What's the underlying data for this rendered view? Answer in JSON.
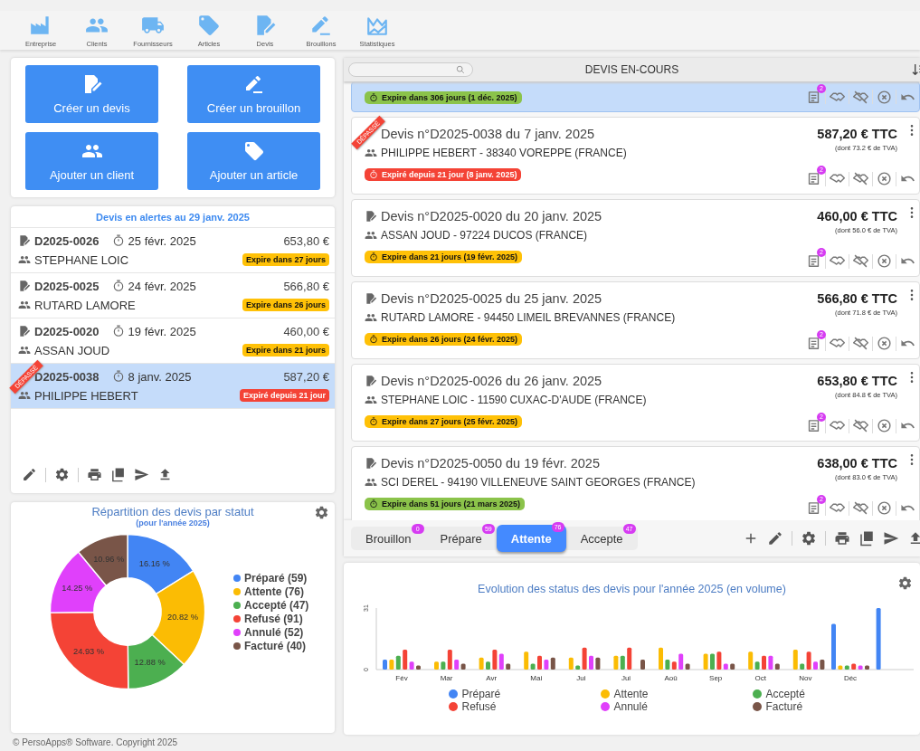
{
  "nav": [
    {
      "label": "Entreprise"
    },
    {
      "label": "Clients"
    },
    {
      "label": "Fournisseurs"
    },
    {
      "label": "Articles"
    },
    {
      "label": "Devis"
    },
    {
      "label": "Brouillons"
    },
    {
      "label": "Statistiques"
    }
  ],
  "quick_actions": [
    "Créer un devis",
    "Créer un brouillon",
    "Ajouter un client",
    "Ajouter un article"
  ],
  "alerts": {
    "title": "Devis en alertes au 29 janv. 2025",
    "rows": [
      {
        "number": "D2025-0026",
        "date": "25 févr. 2025",
        "amount": "653,80 €",
        "client": "STEPHANE LOIC",
        "badge": "Expire dans 27 jours",
        "color": "#ffc107",
        "selected": false
      },
      {
        "number": "D2025-0025",
        "date": "24 févr. 2025",
        "amount": "566,80 €",
        "client": "RUTARD LAMORE",
        "badge": "Expire dans 26 jours",
        "color": "#ffc107",
        "selected": false
      },
      {
        "number": "D2025-0020",
        "date": "19 févr. 2025",
        "amount": "460,00 €",
        "client": "ASSAN JOUD",
        "badge": "Expire dans 21 jours",
        "color": "#ffc107",
        "selected": false
      },
      {
        "number": "D2025-0038",
        "date": "8 janv. 2025",
        "amount": "587,20 €",
        "client": "PHILIPPE HEBERT",
        "badge": "Expiré depuis 21 jour",
        "color": "#f44336",
        "ribbon": "DÉPASSÉ",
        "selected": true
      }
    ]
  },
  "status_chart": {
    "subtitle": "(pour l'année 2025)",
    "chart_data": {
      "type": "donut",
      "title": "Répartition des devis par statut",
      "categories": [
        "Préparé (59)",
        "Attente (76)",
        "Accepté (47)",
        "Refusé (91)",
        "Annulé (52)",
        "Facturé (40)"
      ],
      "values": [
        16.16,
        20.82,
        12.88,
        24.93,
        14.25,
        10.96
      ],
      "legend": "right",
      "colors": [
        "#4285f4",
        "#fbbc04",
        "#4caf50",
        "#f44336",
        "#e040fb",
        "#795548"
      ],
      "value_labels": [
        "16.16 %",
        "20.82 %",
        "12.88 %",
        "24.93 %",
        "14.25 %",
        "10.96 %"
      ]
    }
  },
  "footer": "© PersoApps® Software. Copyright 2025",
  "quotes": {
    "title": "DEVIS EN-COURS",
    "cards": [
      {
        "badge": "Expire dans 306 jours (1 déc. 2025)",
        "color": "#8bc34a",
        "note_count": "2",
        "selected": true
      },
      {
        "title": "Devis n°D2025-0038 du 7 janv. 2025",
        "client": "PHILIPPE HEBERT - 38340 VOREPPE (FRANCE)",
        "amount": "587,20 € TTC",
        "tax": "(dont 73.2 € de TVA)",
        "badge": "Expiré depuis 21 jour (8 janv. 2025)",
        "color": "#f44336",
        "ribbon": "DÉPASSÉ",
        "note_count": "2",
        "selected": false
      },
      {
        "title": "Devis n°D2025-0020 du 20 janv. 2025",
        "client": "ASSAN JOUD - 97224 DUCOS (FRANCE)",
        "amount": "460,00 € TTC",
        "tax": "(dont 56.0 € de TVA)",
        "badge": "Expire dans 21 jours (19 févr. 2025)",
        "color": "#ffc107",
        "note_count": "2",
        "selected": false
      },
      {
        "title": "Devis n°D2025-0025 du 25 janv. 2025",
        "client": "RUTARD LAMORE - 94450 LIMEIL BREVANNES (FRANCE)",
        "amount": "566,80 € TTC",
        "tax": "(dont 71.8 € de TVA)",
        "badge": "Expire dans 26 jours (24 févr. 2025)",
        "color": "#ffc107",
        "note_count": "2",
        "selected": false
      },
      {
        "title": "Devis n°D2025-0026 du 26 janv. 2025",
        "client": "STEPHANE LOIC - 11590 CUXAC-D'AUDE (FRANCE)",
        "amount": "653,80 € TTC",
        "tax": "(dont 84.8 € de TVA)",
        "badge": "Expire dans 27 jours (25 févr. 2025)",
        "color": "#ffc107",
        "note_count": "2",
        "selected": false
      },
      {
        "title": "Devis n°D2025-0050 du 19 févr. 2025",
        "client": "SCI DEREL - 94190 VILLENEUVE SAINT GEORGES (FRANCE)",
        "amount": "638,00 € TTC",
        "tax": "(dont 83.0 € de TVA)",
        "badge": "Expire dans 51 jours (21 mars 2025)",
        "color": "#8bc34a",
        "note_count": "2",
        "selected": false
      }
    ],
    "tabs": [
      {
        "label": "Brouillon",
        "count": "0",
        "selected": false
      },
      {
        "label": "Prépare",
        "count": "59",
        "selected": false
      },
      {
        "label": "Attente",
        "count": "76",
        "selected": true
      },
      {
        "label": "Accepte",
        "count": "47",
        "selected": false
      }
    ]
  },
  "evolution_chart": {
    "chart_data": {
      "type": "bar",
      "title": "Evolution des status des devis pour l'année 2025 (en volume)",
      "categories": [
        "Fév",
        "Mar",
        "Avr",
        "Mai",
        "Jui",
        "Jui",
        "Aoû",
        "Sep",
        "Oct",
        "Nov",
        "Déc",
        null
      ],
      "ylim": [
        0,
        31
      ],
      "yticks": [
        0,
        31
      ],
      "legend": "bottom",
      "series": [
        {
          "name": "Préparé",
          "color": "#4285f4",
          "values": [
            5,
            null,
            null,
            null,
            null,
            null,
            null,
            null,
            null,
            null,
            23,
            31
          ]
        },
        {
          "name": "Attente",
          "color": "#fbbc04",
          "values": [
            5,
            4,
            6,
            9,
            6,
            7,
            11,
            8,
            9,
            10,
            2,
            null
          ]
        },
        {
          "name": "Accepté",
          "color": "#4caf50",
          "values": [
            7,
            4,
            4,
            3,
            2,
            7,
            5,
            8,
            4,
            3,
            2,
            null
          ]
        },
        {
          "name": "Refusé",
          "color": "#f44336",
          "values": [
            10,
            10,
            10,
            7,
            11,
            11,
            4,
            9,
            7,
            9,
            3,
            null
          ]
        },
        {
          "name": "Annulé",
          "color": "#e040fb",
          "values": [
            4,
            5,
            8,
            5,
            7,
            null,
            8,
            3,
            7,
            4,
            2,
            null
          ]
        },
        {
          "name": "Facturé",
          "color": "#795548",
          "values": [
            2,
            3,
            3,
            6,
            6,
            5,
            3,
            3,
            3,
            5,
            2,
            null
          ]
        }
      ]
    }
  }
}
